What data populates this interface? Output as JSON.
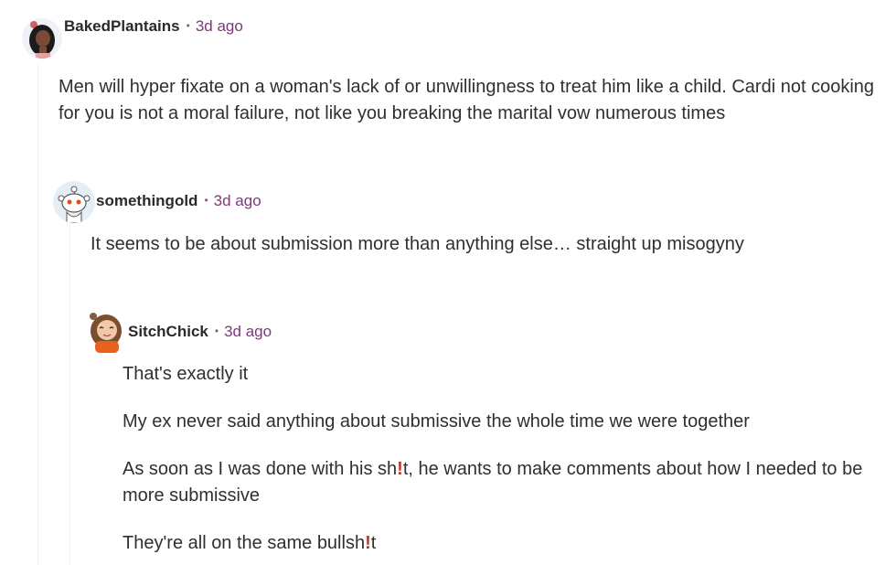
{
  "comments": [
    {
      "username": "BakedPlantains",
      "separator": "•",
      "time": "3d ago",
      "body": [
        "Men will hyper fixate on a woman's lack of or unwillingness to treat him like a child. Cardi not cooking for you is not a moral failure, not like you breaking the marital vow numerous times"
      ]
    },
    {
      "username": "somethingold",
      "separator": "•",
      "time": "3d ago",
      "body": [
        "It seems to be about submission more than anything else… straight up misogyny"
      ]
    },
    {
      "username": "SitchChick",
      "separator": "•",
      "time": "3d ago",
      "body": [
        "That's exactly it",
        "My ex never said anything about submissive the whole time we were together",
        {
          "before": "As soon as I was done with his sh",
          "censor": "!",
          "after": "t, he wants to make comments about how I needed to be more submissive"
        },
        {
          "before": "They're all on the same bullsh",
          "censor": "!",
          "after": "t"
        }
      ]
    }
  ],
  "colors": {
    "accent": "#7a3a7a",
    "censor": "#c8322b",
    "thread_line": "#eef0f1"
  }
}
